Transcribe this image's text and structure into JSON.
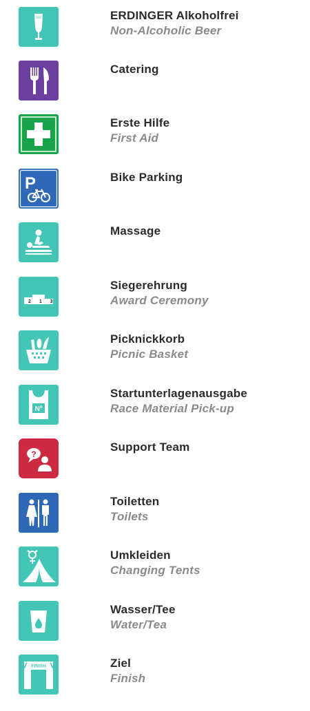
{
  "colors": {
    "teal": "#43c6b5",
    "purple": "#6a3fa0",
    "green": "#17a44a",
    "blue": "#2f68b6",
    "red": "#cc2a42",
    "title_text": "#2b2b2b",
    "subtitle_text": "#8a8a8a"
  },
  "items": [
    {
      "title": "ERDINGER Alkoholfrei",
      "subtitle": "Non-Alcoholic Beer",
      "icon": "beer-glass-icon"
    },
    {
      "title": "Catering",
      "subtitle": "",
      "icon": "fork-knife-icon"
    },
    {
      "title": "Erste Hilfe",
      "subtitle": "First Aid",
      "icon": "first-aid-cross-icon"
    },
    {
      "title": "Bike Parking",
      "subtitle": "",
      "icon": "bike-parking-icon"
    },
    {
      "title": "Massage",
      "subtitle": "",
      "icon": "massage-icon"
    },
    {
      "title": "Siegerehrung",
      "subtitle": "Award Ceremony",
      "icon": "podium-icon",
      "icon_text": "2 1 3"
    },
    {
      "title": "Picknickkorb",
      "subtitle": "Picnic Basket",
      "icon": "picnic-basket-icon"
    },
    {
      "title": "Startunterlagenausgabe",
      "subtitle": "Race Material Pick-up",
      "icon": "race-bib-icon",
      "icon_text": "Nº"
    },
    {
      "title": "Support Team",
      "subtitle": "",
      "icon": "support-team-icon",
      "icon_text": "?"
    },
    {
      "title": "Toiletten",
      "subtitle": "Toilets",
      "icon": "toilets-icon"
    },
    {
      "title": "Umkleiden",
      "subtitle": "Changing Tents",
      "icon": "changing-tent-icon"
    },
    {
      "title": "Wasser/Tee",
      "subtitle": "Water/Tea",
      "icon": "water-cup-icon"
    },
    {
      "title": "Ziel",
      "subtitle": "Finish",
      "icon": "finish-arch-icon",
      "icon_text": "FINISH"
    }
  ]
}
